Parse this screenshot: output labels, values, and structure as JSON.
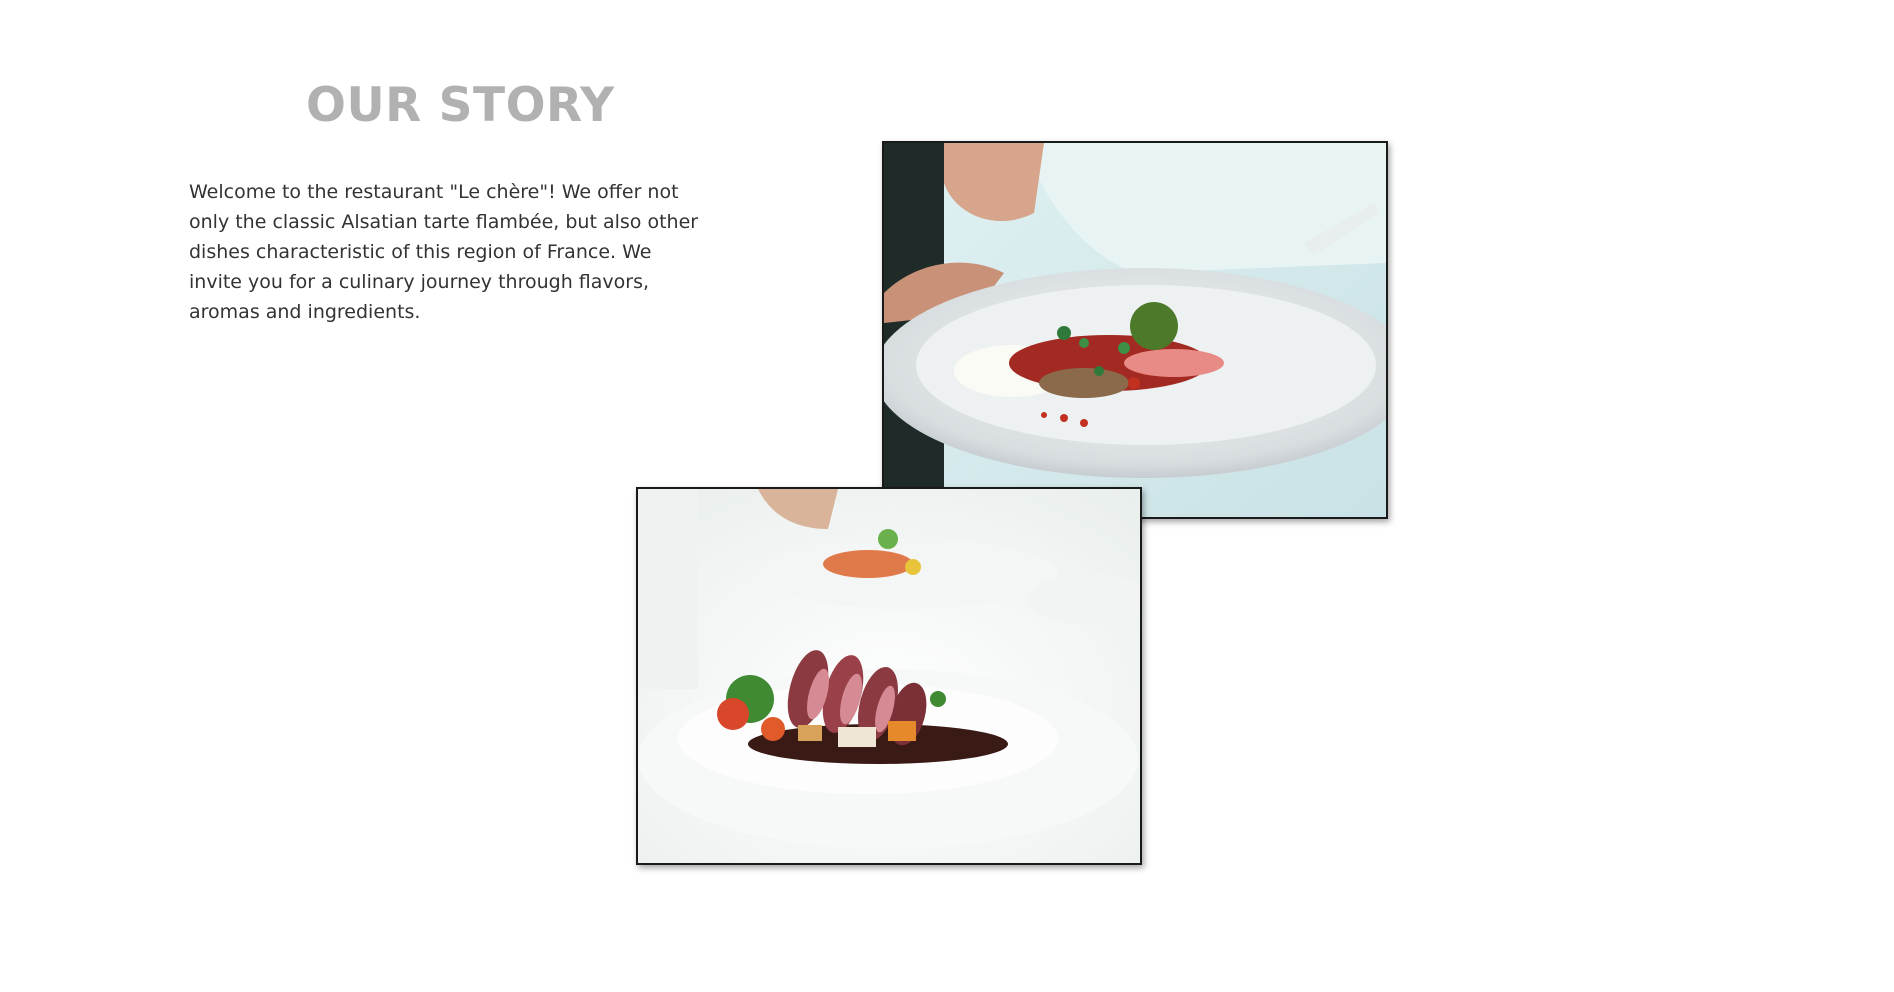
{
  "story": {
    "title": "OUR STORY",
    "text": "Welcome to the restaurant \"Le chère\"! We offer not only the classic Alsatian tarte flambée, but also other dishes characteristic of this region of France. We invite you for a culinary journey through flavors, aromas and ingredients."
  },
  "colors": {
    "title": "#b1b1b1",
    "text": "#333333",
    "photo_border": "#1a1a1a"
  }
}
